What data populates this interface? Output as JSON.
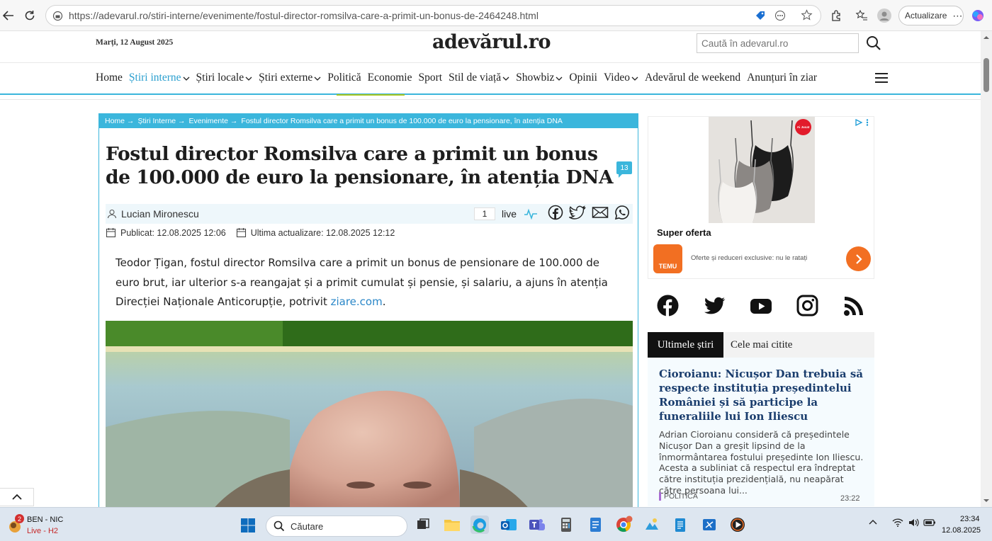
{
  "browser": {
    "url": "https://adevarul.ro/stiri-interne/evenimente/fostul-director-romsilva-care-a-primit-un-bonus-de-2464248.html",
    "update_label": "Actualizare"
  },
  "header": {
    "date": "Marți, 12 August 2025",
    "logo": "adevărul.ro",
    "search_placeholder": "Caută în adevarul.ro"
  },
  "nav": {
    "items": [
      {
        "label": "Home",
        "dropdown": false
      },
      {
        "label": "Știri interne",
        "dropdown": true,
        "active": true
      },
      {
        "label": "Știri locale",
        "dropdown": true
      },
      {
        "label": "Știri externe",
        "dropdown": true
      },
      {
        "label": "Politică",
        "dropdown": false
      },
      {
        "label": "Economie",
        "dropdown": false
      },
      {
        "label": "Sport",
        "dropdown": false
      },
      {
        "label": "Stil de viață",
        "dropdown": true
      },
      {
        "label": "Showbiz",
        "dropdown": true
      },
      {
        "label": "Opinii",
        "dropdown": false
      },
      {
        "label": "Video",
        "dropdown": true
      },
      {
        "label": "Adevărul de weekend",
        "dropdown": false
      },
      {
        "label": "Anunțuri în ziar",
        "dropdown": false
      }
    ]
  },
  "article": {
    "breadcrumb": [
      "Home →",
      "Știri Interne →",
      "Evenimente →",
      "Fostul director Romsilva care a primit un bonus de 100.000 de euro la pensionare, în atenția DNA"
    ],
    "title": "Fostul director Romsilva care a primit un bonus de 100.000 de euro la pensionare, în atenția DNA",
    "comment_count": "13",
    "author": "Lucian Mironescu",
    "live_count": "1",
    "live_label": "live",
    "published": "Publicat: 12.08.2025 12:06",
    "updated": "Ultima actualizare: 12.08.2025 12:12",
    "lead": "Teodor Țigan, fostul director Romsilva care a primit un bonus de pensionare de 100.000 de euro brut, iar ulterior s-a reangajat și a primit cumulat și pensie, și salariu, a ajuns în atenția Direcției Naționale Anticorupție, potrivit ",
    "lead_link": "ziare.com",
    "lead_end": "."
  },
  "ad": {
    "badge": "Ai Jucat",
    "title": "Super oferta",
    "brand": "TEMU",
    "text": "Oferte și reduceri exclusive: nu le ratați"
  },
  "sidebar": {
    "social": [
      "facebook-icon",
      "twitter-icon",
      "youtube-icon",
      "instagram-icon",
      "rss-icon"
    ],
    "tab_latest": "Ultimele știri",
    "tab_most_read": "Cele mai citite",
    "news": {
      "title": "Ciorоianu: Nicușor Dan trebuia să respecte instituția președintelui României și să participe la funeraliile lui Ion Iliescu",
      "summary": "Adrian Cioroianu consideră că președintele Nicușor Dan a greșit lipsind de la înmormântarea fostului președinte Ion Iliescu. Acesta a subliniat că respectul era îndreptat către instituția prezidențială, nu neapărat către persoana lui...",
      "category": "POLITICĂ",
      "time": "23:22"
    }
  },
  "taskbar": {
    "weather_badge": "2",
    "weather_title": "BEN - NIC",
    "weather_sub": "Live - H2",
    "search_label": "Căutare",
    "time": "23:34",
    "date": "12.08.2025"
  },
  "colors": {
    "accent": "#3bb6dc",
    "nav_active": "#2a9fcf",
    "temu": "#f26f22",
    "news_title": "#1a3d6d"
  }
}
